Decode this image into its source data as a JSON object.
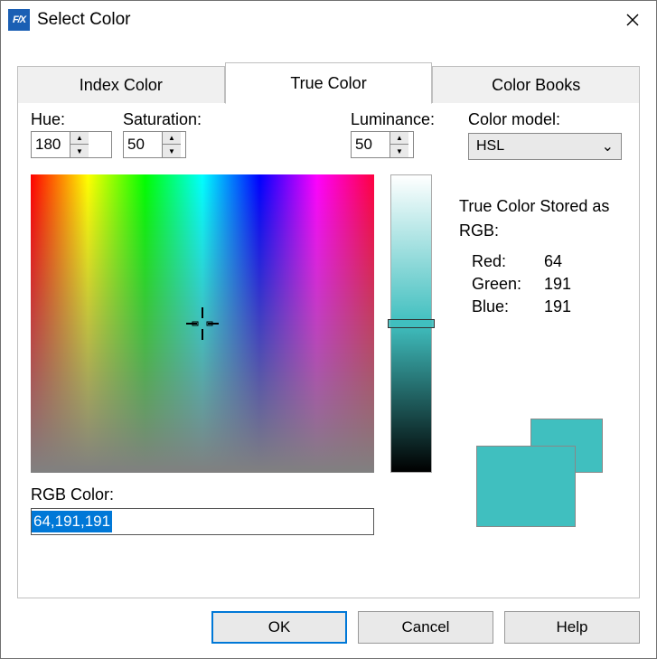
{
  "window": {
    "title": "Select Color",
    "icon_text": "F/X"
  },
  "tabs": {
    "index": "Index Color",
    "true": "True Color",
    "books": "Color Books"
  },
  "hsl": {
    "hue_label": "Hue:",
    "hue_value": "180",
    "sat_label": "Saturation:",
    "sat_value": "50",
    "lum_label": "Luminance:",
    "lum_value": "50"
  },
  "color_model": {
    "label": "Color model:",
    "value": "HSL"
  },
  "stored": {
    "label": "True Color Stored as RGB:",
    "red_label": "Red:",
    "red_value": "64",
    "green_label": "Green:",
    "green_value": "191",
    "blue_label": "Blue:",
    "blue_value": "191"
  },
  "rgb_field": {
    "label": "RGB Color:",
    "value": "64,191,191"
  },
  "swatch_color": "#40bfbf",
  "buttons": {
    "ok": "OK",
    "cancel": "Cancel",
    "help": "Help"
  }
}
